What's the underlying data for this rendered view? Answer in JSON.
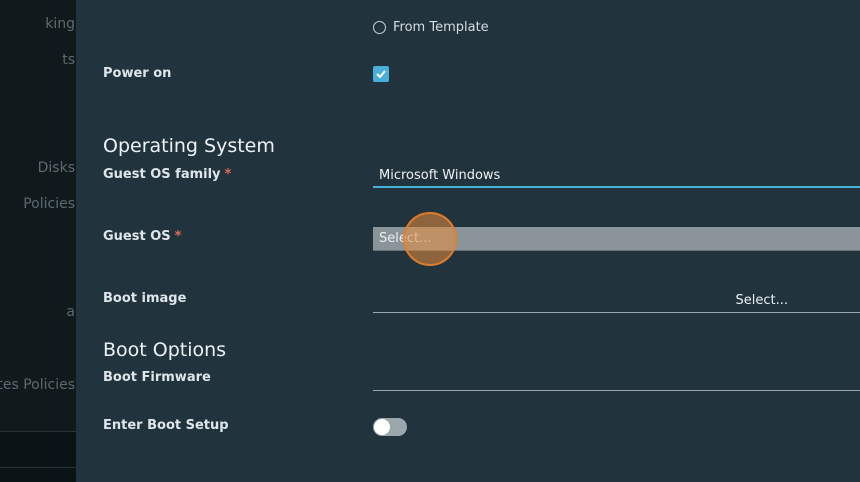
{
  "nav": {
    "items": [
      "king",
      "ts",
      "Disks",
      "Policies",
      "a",
      "tes Policies"
    ]
  },
  "form": {
    "from_template_label": "From Template",
    "power_on_label": "Power on",
    "power_on_checked": true,
    "os_section_title": "Operating System",
    "guest_os_family_label": "Guest OS family",
    "guest_os_family_value": "Microsoft Windows",
    "guest_os_label": "Guest OS",
    "guest_os_value": "Select...",
    "boot_image_label": "Boot image",
    "boot_image_value": "Select...",
    "boot_section_title": "Boot Options",
    "boot_firmware_label": "Boot Firmware",
    "boot_firmware_value": "",
    "enter_boot_setup_label": "Enter Boot Setup",
    "enter_boot_setup_on": false,
    "required_marker": "*"
  },
  "colors": {
    "accent": "#49afd9",
    "required": "#e46a57",
    "click_indicator": "#e8802a"
  }
}
